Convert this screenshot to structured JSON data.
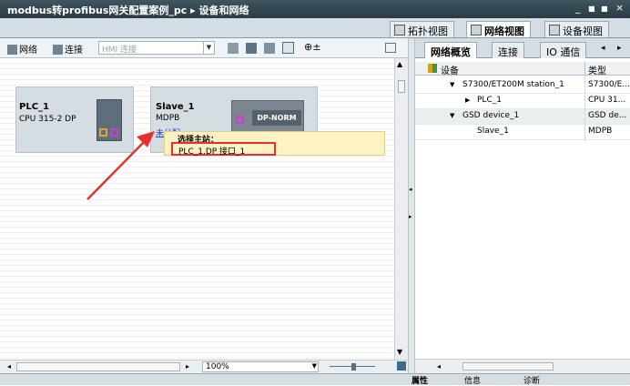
{
  "title_bar": {
    "project": "modbus转profibus网关配置案例_pc",
    "separator": "▸",
    "page": "设备和网络",
    "controls": [
      "_",
      "■",
      "■",
      "×"
    ]
  },
  "view_tabs": [
    {
      "label": "拓扑视图",
      "active": false
    },
    {
      "label": "网络视图",
      "active": true
    },
    {
      "label": "设备视图",
      "active": false
    }
  ],
  "toolbar": {
    "network_label": "网络",
    "connections_label": "连接",
    "hmi_combo": "HMI 连接",
    "zoom_icon": "zoom-icon"
  },
  "canvas": {
    "devices": [
      {
        "name": "PLC_1",
        "type": "CPU 315-2 DP"
      },
      {
        "name": "Slave_1",
        "type": "MDPB",
        "badge": "DP-NORM",
        "link": "未分配"
      }
    ],
    "tooltip": {
      "title": "选择主站：",
      "option": "PLC_1.DP 接口_1"
    },
    "arrow_color": "#e8312f"
  },
  "scrollbar": {
    "zoom": "100%"
  },
  "overview": {
    "tabs": [
      {
        "label": "网络概览",
        "active": true
      },
      {
        "label": "连接",
        "active": false
      },
      {
        "label": "IO 通信",
        "active": false
      }
    ],
    "nav": [
      "◂",
      "▸"
    ],
    "columns": {
      "device": "设备",
      "type": "类型"
    },
    "rows": [
      {
        "device": "S7300/ET200M station_1",
        "type": "S7300/E...",
        "expander": "▼",
        "selected": false
      },
      {
        "device": "PLC_1",
        "type": "CPU 31...",
        "expander": "▶",
        "selected": false
      },
      {
        "device": "GSD device_1",
        "type": "GSD de...",
        "expander": "▼",
        "selected": true
      },
      {
        "device": "Slave_1",
        "type": "MDPB",
        "expander": "",
        "selected": false
      }
    ]
  },
  "bottom_bar": {
    "items": [
      "属性",
      "信息",
      "诊断"
    ]
  }
}
